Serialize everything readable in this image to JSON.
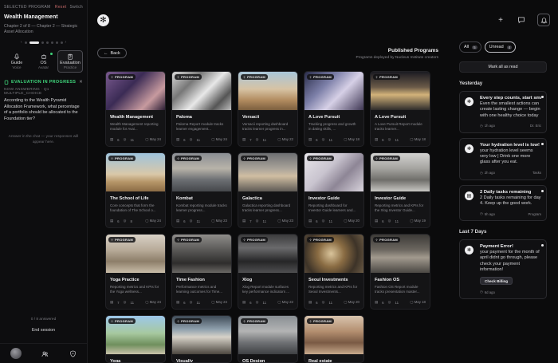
{
  "sidebar": {
    "selected_program_label": "SELECTED PROGRAM",
    "reset_label": "Reset",
    "switch_label": "Switch",
    "program_title": "Wealth Management",
    "chapter_text": "Chapter 2 of 8 — Chapter 2 — Strategic Asset Allocation",
    "tabs": [
      {
        "label": "Guide",
        "sub": "Voice",
        "icon": "mic-icon"
      },
      {
        "label": "OS",
        "sub": "Avatar",
        "icon": "avatar-icon"
      },
      {
        "label": "Evaluation",
        "sub": "Practice",
        "icon": "clipboard-icon"
      }
    ],
    "eval": {
      "status": "EVALUATION IN PROGRESS",
      "meta": "NOW ANSWERING · Q1 · MULTIPLE_CHOICE",
      "question": "According to the Wealth Pyramid Allocation Framework, what percentage of a portfolio should be allocated to the Foundation tier?",
      "hint": "Answer in the chat — your responses will appear here."
    },
    "answered": "0 / 8 answered",
    "end_session": "End session"
  },
  "main": {
    "back_label": "Back",
    "title": "Published Programs",
    "subtitle": "Programs deployed by Nucleus Institute creators",
    "pill_label": "PROGRAM",
    "cards": [
      {
        "name": "Wealth Management",
        "desc": "Wealth Management reporting module for Avai...",
        "a": "6",
        "b": "11",
        "date": "May 24",
        "bg": "linear-gradient(135deg,#7a5a8f 0%,#3b2b55 40%,#c79a9f 75%,#2a1d33 100%)"
      },
      {
        "name": "Paloma",
        "desc": "Paloma Report module tracks learner engagement...",
        "a": "6",
        "b": "11",
        "date": "May 24",
        "bg": "linear-gradient(135deg,#d9d9d9 0%,#777 30%,#e8e8e8 55%,#555 80%,#bcbcbc 100%)"
      },
      {
        "name": "Versacii",
        "desc": "Versacii reporting dashboard tracks learner progress in...",
        "a": "7",
        "b": "11",
        "date": "May 22",
        "bg": "linear-gradient(180deg,#a9c6d9 0%,#d7c3a4 45%,#b08a5e 75%,#7b5e3e 100%)"
      },
      {
        "name": "A Love Pursuit",
        "desc": "Tracking progress and growth in dating skills, ...",
        "a": "6",
        "b": "11",
        "date": "May 18",
        "bg": "linear-gradient(135deg,#2a2d4a 0%,#7c7fa8 35%,#d6d0e6 60%,#3d3552 100%)"
      },
      {
        "name": "A Love Pursuit",
        "desc": "A Love Pursuit Report module tracks learner...",
        "a": "6",
        "b": "11",
        "date": "May 18",
        "bg": "linear-gradient(180deg,#1b1b22 0%,#6a5a48 40%,#d2b27a 60%,#2e2b2b 100%)"
      },
      {
        "name": "The School of Life",
        "desc": "Core concepts that form the foundation of The School o...",
        "a": "6",
        "b": "8",
        "date": "May 24",
        "bg": "linear-gradient(180deg,#9fc3dc 0%,#d9c8a8 55%,#b69668 75%,#8b6b45 100%)"
      },
      {
        "name": "Kombat",
        "desc": "Kombat reporting module tracks learner progress...",
        "a": "6",
        "b": "11",
        "date": "May 23",
        "bg": "linear-gradient(180deg,#8a8e93 0%,#b8b3a9 40%,#6b6e72 70%,#45474b 100%)"
      },
      {
        "name": "Galactica",
        "desc": "Galactica reporting dashboard tracks learner progress...",
        "a": "7",
        "b": "11",
        "date": "May 23",
        "bg": "linear-gradient(180deg,#6d6f72 0%,#a9a39a 40%,#d0bea2 60%,#5e5a55 100%)"
      },
      {
        "name": "Investor Guide",
        "desc": "Reporting dashboard for Investor Guide learners and...",
        "a": "6",
        "b": "11",
        "date": "May 20",
        "bg": "linear-gradient(135deg,#e8e6ea 0%,#c9c4cf 40%,#8e8696 65%,#d9d4dd 100%)"
      },
      {
        "name": "Investor Guide",
        "desc": "Reporting metrics and KPIs for the Xlog Investor Guide...",
        "a": "6",
        "b": "11",
        "date": "May 19",
        "bg": "linear-gradient(180deg,#d2d2d0 0%,#a5a4a0 40%,#6f6e6a 70%,#c8c7c3 100%)"
      },
      {
        "name": "Yoga Practice",
        "desc": "Reporting metrics and KPIs for the Yoga wellness...",
        "a": "7",
        "b": "11",
        "date": "May 24",
        "bg": "linear-gradient(180deg,#d8d1c6 0%,#b8ab99 40%,#8d7e69 70%,#c9bda9 100%)"
      },
      {
        "name": "Time Fashion",
        "desc": "Performance metrics and learning outcomes for Time...",
        "a": "6",
        "b": "11",
        "date": "May 24",
        "bg": "linear-gradient(180deg,#8f8d8a 0%,#5a5957 40%,#2e2d2c 75%,#6a6865 100%)"
      },
      {
        "name": "Xlog",
        "desc": "Xlog Report module surfaces key performance indicators ...",
        "a": "6",
        "b": "11",
        "date": "May 22",
        "bg": "linear-gradient(180deg,#3b3b3c 0%,#6a6a6c 35%,#262627 70%,#4f4f51 100%)"
      },
      {
        "name": "Seoul Investments",
        "desc": "Reporting metrics and KPIs for Seoul Investments...",
        "a": "6",
        "b": "11",
        "date": "May 20",
        "bg": "radial-gradient(circle at 45% 50%,#d9c49b 0%,#8a6c43 35%,#3d3328 70%,#6a5a44 100%)"
      },
      {
        "name": "Fashion OS",
        "desc": "Fashion OS Report module tracks presentation master...",
        "a": "6",
        "b": "11",
        "date": "May 18",
        "bg": "linear-gradient(180deg,#3c3a37 0%,#6c6760 40%,#a29a8e 60%,#4a4743 100%)"
      },
      {
        "name": "Yoga",
        "desc": "",
        "a": "",
        "b": "",
        "date": "",
        "bg": "linear-gradient(180deg,#9cc7ea 0%,#a7c9a0 45%,#6f8f5d 75%,#c9c2aa 100%)"
      },
      {
        "name": "Visually",
        "desc": "",
        "a": "",
        "b": "",
        "date": "",
        "bg": "linear-gradient(180deg,#3f4b57 0%,#8fa0ad 35%,#d7d2c8 55%,#4b463f 100%)"
      },
      {
        "name": "OS Design",
        "desc": "",
        "a": "",
        "b": "",
        "date": "",
        "bg": "linear-gradient(180deg,#8a8f94 0%,#b3b4b4 40%,#6e7073 70%,#3e4043 100%)"
      },
      {
        "name": "Real estate",
        "desc": "",
        "a": "",
        "b": "",
        "date": "",
        "bg": "linear-gradient(180deg,#d8c4ae 0%,#b48f70 40%,#7a5a44 70%,#c7a98b 100%)"
      }
    ]
  },
  "notifications": {
    "all_label": "All",
    "all_count": "5",
    "unread_label": "Unread",
    "unread_count": "4",
    "mark_all": "Mark all as read",
    "yesterday": "Yesterday",
    "last7": "Last 7 Days",
    "items": [
      {
        "title": "Every step counts, start sma",
        "body": "Even the smallest actions can create lasting change — begin with one healthy choice today",
        "time": "1h ago",
        "source": "Dr. Eric",
        "icon": "gear-icon"
      },
      {
        "title": "Your hydration level is low!",
        "body": "your hydration level seems very low | Drink one more glass after you eat.",
        "time": "2h ago",
        "source": "Tasks",
        "icon": "gear-icon"
      },
      {
        "title": "2 Daily tasks remaining",
        "body": "2 Daily tasks remaining for day 4. Keep up the good work.",
        "time": "5h ago",
        "source": "Program",
        "icon": "clipboard-icon"
      },
      {
        "title": "Payment Error!",
        "body": "your payment for the month of april didnt go through, please check your payment information!",
        "time": "6d ago",
        "source": "",
        "icon": "gear-icon",
        "cta": "Check Billing"
      }
    ]
  }
}
